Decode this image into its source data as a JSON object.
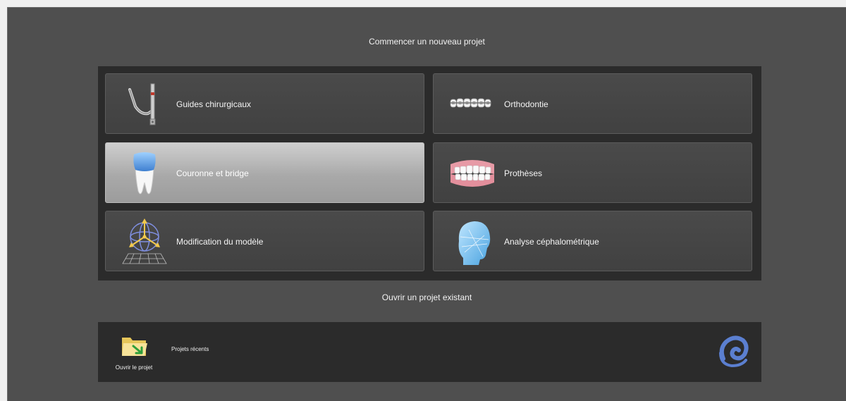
{
  "new_project": {
    "title": "Commencer un nouveau projet",
    "tiles": [
      {
        "label": "Guides chirurgicaux",
        "icon": "surgical-guide-icon"
      },
      {
        "label": "Orthodontie",
        "icon": "braces-icon"
      },
      {
        "label": "Couronne et bridge",
        "icon": "crown-tooth-icon",
        "selected": true
      },
      {
        "label": "Prothèses",
        "icon": "denture-icon"
      },
      {
        "label": "Modification du modèle",
        "icon": "model-transform-icon"
      },
      {
        "label": "Analyse céphalométrique",
        "icon": "cephalometric-head-icon"
      }
    ]
  },
  "open_project": {
    "title": "Ouvrir un projet existant",
    "open_label": "Ouvrir le projet",
    "recent_label": "Projets récents"
  },
  "colors": {
    "window_bg": "#4f4f4f",
    "panel_bg": "#2b2b2b",
    "tile_bg": "#454545",
    "tile_selected_bg": "#b5b5b5",
    "logo_blue": "#5b7fd0"
  }
}
